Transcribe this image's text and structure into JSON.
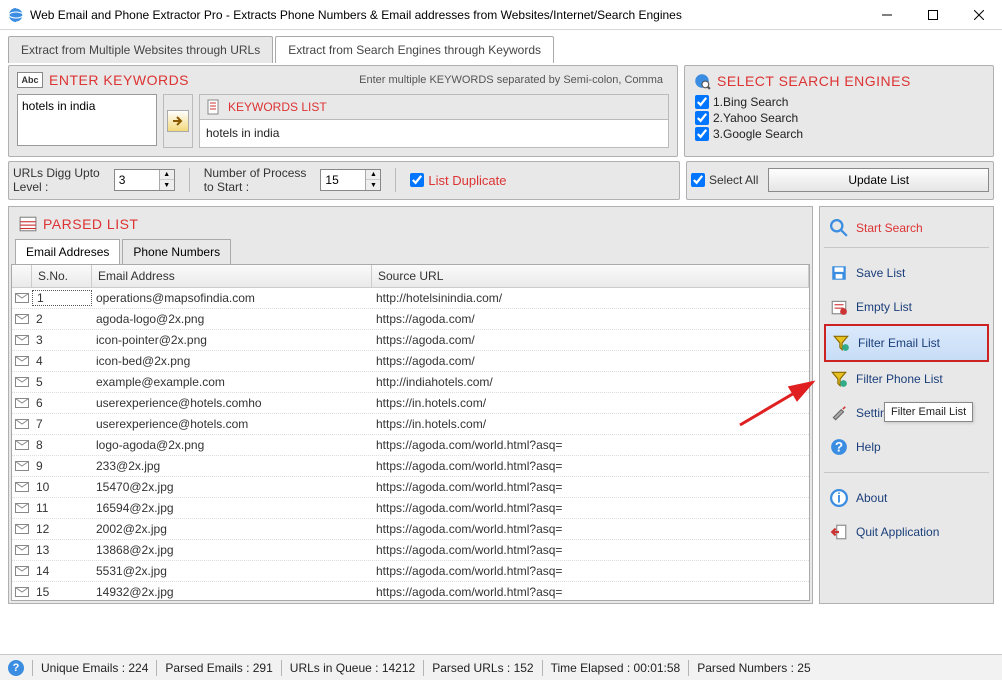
{
  "window": {
    "title": "Web Email and Phone Extractor Pro - Extracts Phone Numbers & Email addresses from Websites/Internet/Search Engines"
  },
  "tabs": {
    "urls": "Extract from Multiple Websites through URLs",
    "keywords": "Extract from Search Engines through Keywords"
  },
  "keywords_panel": {
    "abc": "Abc",
    "title": "ENTER KEYWORDS",
    "hint": "Enter multiple KEYWORDS separated by Semi-colon, Comma",
    "input_value": "hotels in india",
    "list_title": "KEYWORDS LIST",
    "list_item": "hotels in india"
  },
  "digg": {
    "label": "URLs Digg Upto\nLevel :",
    "value": "3",
    "proc_label": "Number of Process\nto Start :",
    "proc_value": "15",
    "dup_label": "List Duplicate"
  },
  "se_panel": {
    "title": "SELECT SEARCH ENGINES",
    "engines": [
      "1.Bing Search",
      "2.Yahoo Search",
      "3.Google Search"
    ],
    "select_all": "Select All",
    "update_btn": "Update List"
  },
  "parsed": {
    "title": "PARSED LIST",
    "tab_email": "Email Addreses",
    "tab_phone": "Phone Numbers",
    "col_sno": "S.No.",
    "col_email": "Email Address",
    "col_url": "Source URL",
    "rows": [
      {
        "n": "1",
        "e": "operations@mapsofindia.com",
        "u": "http://hotelsinindia.com/"
      },
      {
        "n": "2",
        "e": "agoda-logo@2x.png",
        "u": "https://agoda.com/"
      },
      {
        "n": "3",
        "e": "icon-pointer@2x.png",
        "u": "https://agoda.com/"
      },
      {
        "n": "4",
        "e": "icon-bed@2x.png",
        "u": "https://agoda.com/"
      },
      {
        "n": "5",
        "e": "example@example.com",
        "u": "http://indiahotels.com/"
      },
      {
        "n": "6",
        "e": "userexperience@hotels.comho",
        "u": "https://in.hotels.com/"
      },
      {
        "n": "7",
        "e": "userexperience@hotels.com",
        "u": "https://in.hotels.com/"
      },
      {
        "n": "8",
        "e": "logo-agoda@2x.png",
        "u": "https://agoda.com/world.html?asq="
      },
      {
        "n": "9",
        "e": "233@2x.jpg",
        "u": "https://agoda.com/world.html?asq="
      },
      {
        "n": "10",
        "e": "15470@2x.jpg",
        "u": "https://agoda.com/world.html?asq="
      },
      {
        "n": "11",
        "e": "16594@2x.jpg",
        "u": "https://agoda.com/world.html?asq="
      },
      {
        "n": "12",
        "e": "2002@2x.jpg",
        "u": "https://agoda.com/world.html?asq="
      },
      {
        "n": "13",
        "e": "13868@2x.jpg",
        "u": "https://agoda.com/world.html?asq="
      },
      {
        "n": "14",
        "e": "5531@2x.jpg",
        "u": "https://agoda.com/world.html?asq="
      },
      {
        "n": "15",
        "e": "14932@2x.jpg",
        "u": "https://agoda.com/world.html?asq="
      }
    ]
  },
  "side": {
    "start": "Start Search",
    "save": "Save List",
    "empty": "Empty List",
    "filter_email": "Filter Email List",
    "filter_phone": "Filter Phone List",
    "settings": "Settings",
    "help": "Help",
    "about": "About",
    "quit": "Quit Application"
  },
  "tooltip": {
    "text": "Filter Email List"
  },
  "status": {
    "unique": "Unique Emails :  224",
    "parsed_e": "Parsed Emails :  291",
    "queue": "URLs in Queue :  14212",
    "parsed_u": "Parsed URLs :  152",
    "time": "Time Elapsed :  00:01:58",
    "parsed_n": "Parsed Numbers :  25"
  }
}
